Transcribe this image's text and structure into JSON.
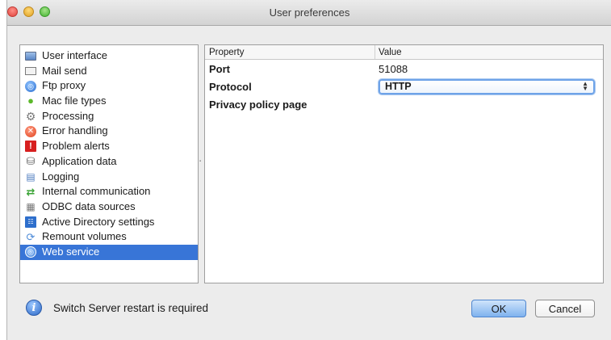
{
  "window": {
    "title": "User preferences"
  },
  "sidebar": {
    "items": [
      {
        "label": "User interface",
        "icon": "monitor-icon"
      },
      {
        "label": "Mail send",
        "icon": "mail-icon"
      },
      {
        "label": "Ftp proxy",
        "icon": "ftp-globe-icon"
      },
      {
        "label": "Mac file types",
        "icon": "apple-icon"
      },
      {
        "label": "Processing",
        "icon": "gear-icon"
      },
      {
        "label": "Error handling",
        "icon": "error-icon"
      },
      {
        "label": "Problem alerts",
        "icon": "alert-icon"
      },
      {
        "label": "Application data",
        "icon": "database-icon"
      },
      {
        "label": "Logging",
        "icon": "log-document-icon"
      },
      {
        "label": "Internal communication",
        "icon": "sync-arrows-icon"
      },
      {
        "label": "ODBC data sources",
        "icon": "odbc-icon"
      },
      {
        "label": "Active Directory settings",
        "icon": "active-directory-icon"
      },
      {
        "label": "Remount volumes",
        "icon": "remount-icon"
      },
      {
        "label": "Web service",
        "icon": "web-service-icon",
        "selected": true
      }
    ]
  },
  "properties": {
    "headers": {
      "property": "Property",
      "value": "Value"
    },
    "rows": [
      {
        "property": "Port",
        "value": "51088"
      },
      {
        "property": "Protocol",
        "value": "HTTP",
        "control": "select"
      },
      {
        "property": "Privacy policy page",
        "value": ""
      }
    ]
  },
  "footer": {
    "message": "Switch Server restart is required",
    "ok_label": "OK",
    "cancel_label": "Cancel"
  },
  "colors": {
    "selection": "#3875d7",
    "accent": "#6ea3e8"
  }
}
